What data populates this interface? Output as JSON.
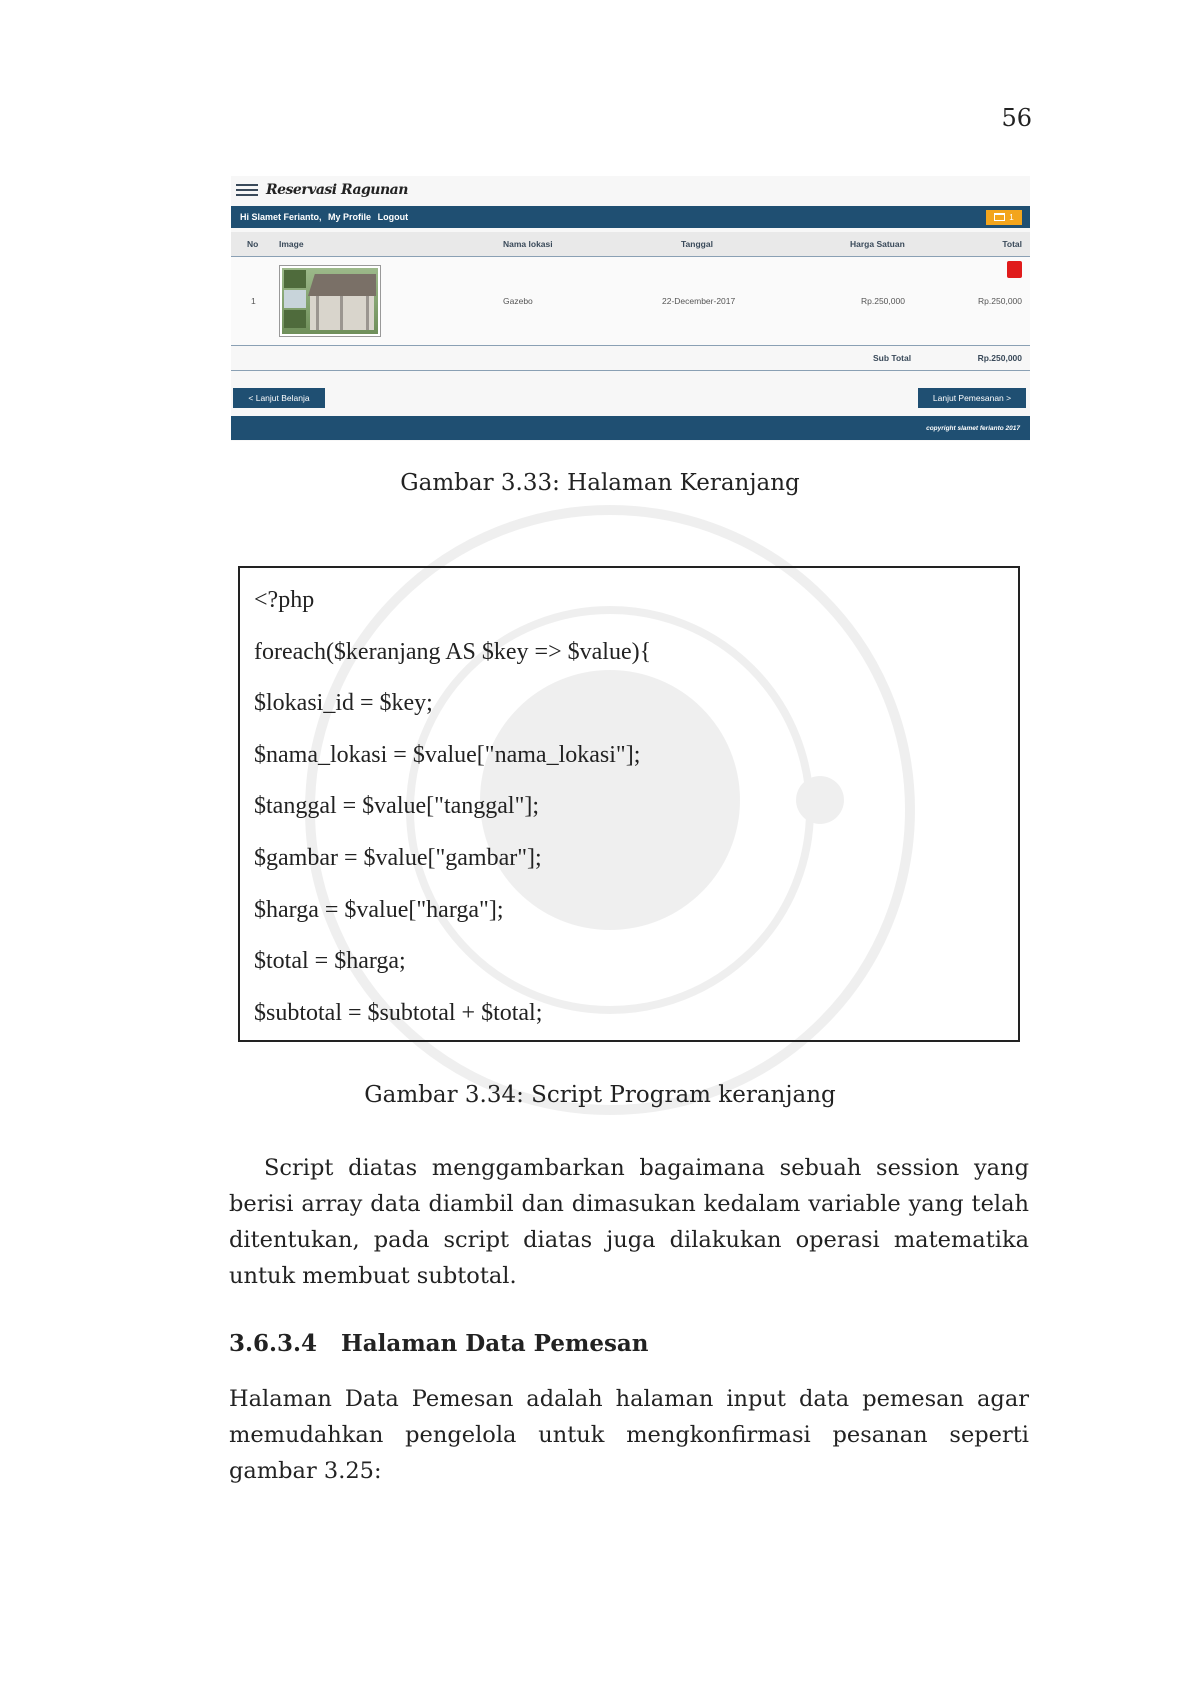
{
  "page_number": "56",
  "figure_1": {
    "app": {
      "title": "Reservasi Ragunan",
      "user_greeting": "Hi Slamet Ferianto,",
      "profile_link": "My Profile",
      "logout_link": "Logout",
      "cart_count": "1",
      "accent_color": "#1f4f72",
      "cart_color": "#f3a51d",
      "delete_color": "#e01b1b"
    },
    "table": {
      "headers": {
        "no": "No",
        "image": "Image",
        "location": "Nama lokasi",
        "date": "Tanggal",
        "unit_price": "Harga Satuan",
        "total": "Total"
      },
      "row": {
        "no": "1",
        "location": "Gazebo",
        "date": "22-December-2017",
        "unit_price": "Rp.250,000",
        "total": "Rp.250,000"
      },
      "subtotal_label": "Sub Total",
      "subtotal_value": "Rp.250,000"
    },
    "buttons": {
      "back": "< Lanjut Belanja",
      "next": "Lanjut Pemesanan >"
    },
    "footer": "copyright slamet ferianto 2017",
    "caption": "Gambar 3.33: Halaman Keranjang"
  },
  "figure_2": {
    "code_lines": [
      "<?php",
      "foreach($keranjang AS $key => $value){",
      "$lokasi_id = $key;",
      "$nama_lokasi = $value[\"nama_lokasi\"];",
      "$tanggal = $value[\"tanggal\"];",
      "$gambar = $value[\"gambar\"];",
      "$harga = $value[\"harga\"];",
      "$total = $harga;",
      "$subtotal = $subtotal + $total;"
    ],
    "caption": "Gambar 3.34: Script Program keranjang"
  },
  "paragraph_1": "Script diatas menggambarkan bagaimana sebuah session yang berisi array data diambil dan dimasukan kedalam variable yang telah ditentukan, pada script diatas juga dilakukan operasi matematika untuk membuat subtotal.",
  "section": {
    "number": "3.6.3.4",
    "title": "Halaman Data Pemesan"
  },
  "paragraph_2": "Halaman Data Pemesan adalah halaman input data pemesan agar memudahkan pengelola untuk mengkonfirmasi pesanan seperti gambar 3.25:"
}
